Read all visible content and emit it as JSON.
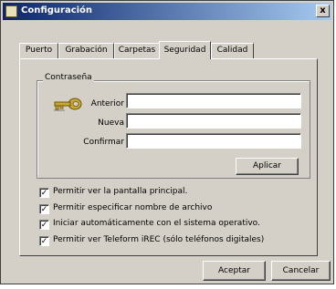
{
  "window": {
    "title": "Configuración",
    "close_label": "x"
  },
  "tabs": [
    {
      "label": "Puerto"
    },
    {
      "label": "Grabación"
    },
    {
      "label": "Carpetas"
    },
    {
      "label": "Seguridad"
    },
    {
      "label": "Calidad"
    }
  ],
  "password": {
    "group_title": "Contraseña",
    "fields": [
      {
        "label": "Anterior",
        "value": ""
      },
      {
        "label": "Nueva",
        "value": ""
      },
      {
        "label": "Confirmar",
        "value": ""
      }
    ],
    "apply_label": "Aplicar"
  },
  "options": [
    {
      "label": "Permitir ver la pantalla principal.",
      "checked": "✓"
    },
    {
      "label": "Permitir especificar nombre de archivo",
      "checked": "✓"
    },
    {
      "label": "Iniciar automáticamente con el sistema operativo.",
      "checked": "✓"
    },
    {
      "label": "Permitir ver Teleform iREC (sólo teléfonos digitales)",
      "checked": "✓"
    }
  ],
  "footer": {
    "accept_label": "Aceptar",
    "cancel_label": "Cancelar"
  }
}
